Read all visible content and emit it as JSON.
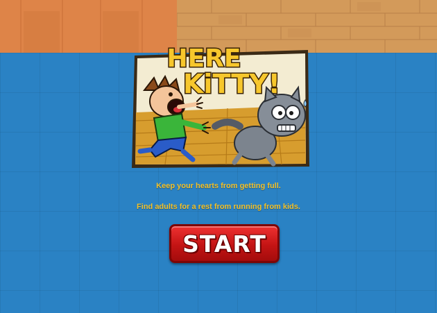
{
  "game": {
    "title_line1": "HERE",
    "title_line2": "KiTTY!",
    "instructions": [
      "Keep your hearts from getting full.",
      "Find adults for a rest from running from kids."
    ],
    "start_label": "START"
  },
  "colors": {
    "floor": "#2a82c4",
    "wall_orange": "#de8448",
    "wall_tan": "#d39a5a",
    "instruction_text": "#f2c12a",
    "title_yellow": "#f7c72c",
    "start_red": "#d11b1b"
  },
  "icons": {
    "boy": "screaming-boy-character",
    "cat": "scared-gray-cat-character"
  }
}
